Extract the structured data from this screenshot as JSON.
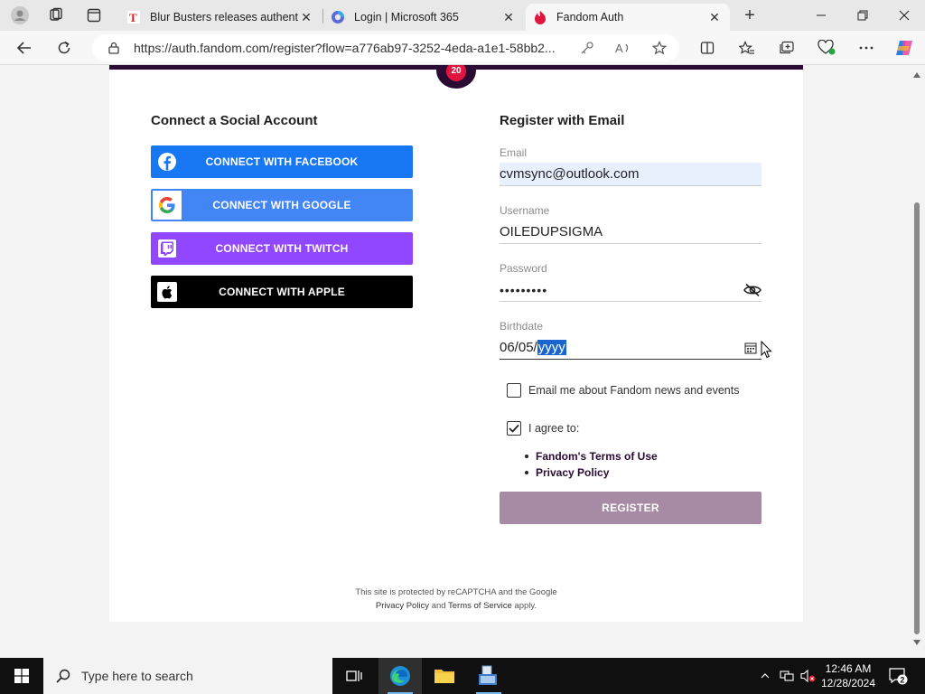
{
  "browser": {
    "tabs": [
      {
        "title": "Blur Busters releases authentic",
        "icon": "blurbusters-favicon-icon"
      },
      {
        "title": "Login | Microsoft 365",
        "icon": "microsoft365-favicon-icon"
      },
      {
        "title": "Fandom Auth",
        "icon": "fandom-favicon-icon",
        "active": true
      }
    ],
    "url": "https://auth.fandom.com/register?flow=a776ab97-3252-4eda-a1e1-58bb2..."
  },
  "page": {
    "badge_text": "20",
    "social": {
      "title": "Connect a Social Account",
      "facebook_label": "CONNECT WITH FACEBOOK",
      "google_label": "CONNECT WITH GOOGLE",
      "twitch_label": "CONNECT WITH TWITCH",
      "apple_label": "CONNECT WITH APPLE"
    },
    "register": {
      "title": "Register with Email",
      "email_label": "Email",
      "email_value": "cvmsync@outlook.com",
      "username_label": "Username",
      "username_value": "OILEDUPSIGMA",
      "password_label": "Password",
      "password_value": "•••••••••",
      "birthdate_label": "Birthdate",
      "birthdate_prefix": "06/05/",
      "birthdate_year": "yyyy",
      "newsletter_label": "Email me about Fandom news and events",
      "newsletter_checked": false,
      "agree_label": "I agree to:",
      "agree_checked": true,
      "terms_link": "Fandom's Terms of Use",
      "privacy_link": "Privacy Policy",
      "submit_label": "REGISTER"
    },
    "recaptcha": {
      "line1": "This site is protected by reCAPTCHA and the Google",
      "privacy": "Privacy Policy",
      "and": "and",
      "terms": "Terms of Service",
      "apply": "apply."
    }
  },
  "taskbar": {
    "search_placeholder": "Type here to search",
    "time": "12:46 AM",
    "date": "12/28/2024",
    "notification_count": "2"
  },
  "colors": {
    "fandom_dark": "#2b0a33",
    "facebook": "#1877f2",
    "google": "#4285f4",
    "twitch": "#9146ff",
    "apple": "#000000",
    "register_disabled": "#a78aa4"
  }
}
